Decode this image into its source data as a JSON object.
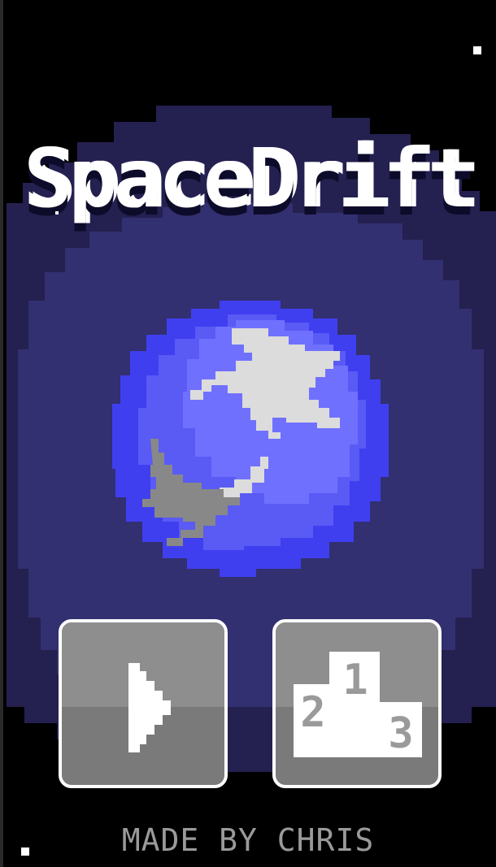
{
  "game": {
    "title": "SpaceDrift",
    "credit": "MADE BY CHRIS"
  },
  "menu": {
    "play_icon": "play-triangle-icon",
    "leaderboard_icon": "podium-icon",
    "podium_places": [
      "1",
      "2",
      "3"
    ]
  },
  "colors": {
    "background": "#000000",
    "nebula_outer": "#242050",
    "nebula_inner": "#323070",
    "planet_rim": "#3f3ff0",
    "planet_mid": "#5a5af5",
    "planet_light": "#7070ff",
    "clouds": "#dcdcdc",
    "clouds_shadow": "#888888",
    "button_top": "#8e8e8e",
    "button_bottom": "#7a7a7a",
    "button_border": "#ffffff",
    "credit_text": "#9a9a9a"
  }
}
